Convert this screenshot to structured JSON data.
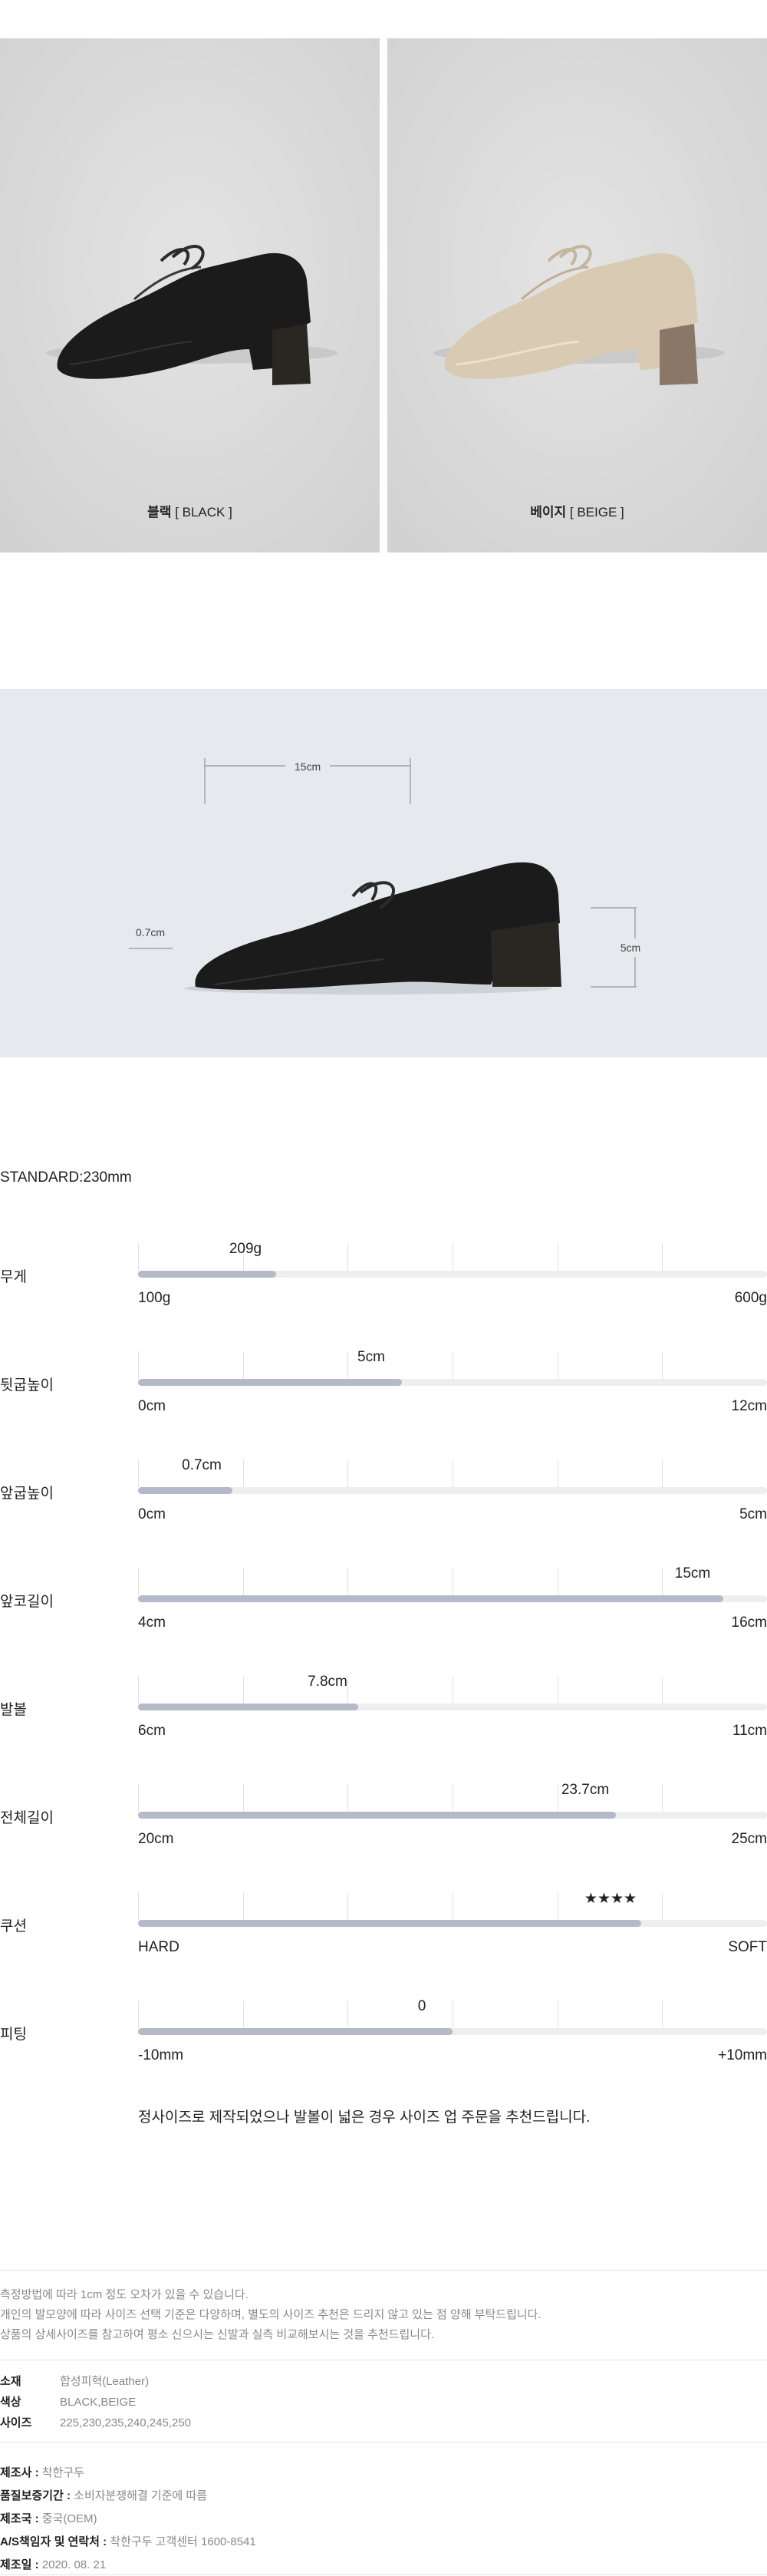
{
  "colors": [
    {
      "name": "블랙",
      "code": "[ BLACK ]",
      "shoe_color": "#1d1d1d",
      "heel_color": "#2a2622",
      "bg": "#dcdcdc"
    },
    {
      "name": "베이지",
      "code": "[ BEIGE ]",
      "shoe_color": "#d8c9b3",
      "heel_color": "#8a7767",
      "bg": "#dcdcdc"
    }
  ],
  "size_diagram": {
    "length": "15cm",
    "toe_height": "0.7cm",
    "heel_height": "5cm",
    "bg": "#e6e9ed"
  },
  "standard": "STANDARD:230mm",
  "specs": [
    {
      "label": "무게",
      "value": "209g",
      "min": "100g",
      "max": "600g",
      "level": 0.22
    },
    {
      "label": "뒷굽높이",
      "value": "5cm",
      "min": "0cm",
      "max": "12cm",
      "level": 0.42
    },
    {
      "label": "앞굽높이",
      "value": "0.7cm",
      "min": "0cm",
      "max": "5cm",
      "level": 0.15
    },
    {
      "label": "앞코길이",
      "value": "15cm",
      "min": "4cm",
      "max": "16cm",
      "level": 0.93
    },
    {
      "label": "발볼",
      "value": "7.8cm",
      "min": "6cm",
      "max": "11cm",
      "level": 0.35
    },
    {
      "label": "전체길이",
      "value": "23.7cm",
      "min": "20cm",
      "max": "25cm",
      "level": 0.76
    },
    {
      "label": "쿠션",
      "value": "★★★★",
      "min": "HARD",
      "max": "SOFT",
      "level": 0.8
    },
    {
      "label": "피팅",
      "value": "0",
      "min": "-10mm",
      "max": "+10mm",
      "level": 0.5
    }
  ],
  "note": "정사이즈로 제작되었으나 발볼이 넓은 경우 사이즈 업 주문을 추천드립니다.",
  "measure_notes": [
    "측정방법에 따라 1cm 정도 오차가 있을 수 있습니다.",
    "개인의 발모양에 따라 사이즈 선택 기준은 다양하며, 별도의 사이즈 추천은 드리지 않고 있는 점 양해 부탁드립니다.",
    "상품의 상세사이즈를 참고하여 평소 신으시는 신발과 실측 비교해보시는 것을 추천드립니다."
  ],
  "info": [
    {
      "k": "소재",
      "v": "합성피혁(Leather)"
    },
    {
      "k": "색상",
      "v": "BLACK,BEIGE"
    },
    {
      "k": "사이즈",
      "v": "225,230,235,240,245,250"
    }
  ],
  "maker": [
    {
      "k": "제조사 :",
      "v": "착한구두"
    },
    {
      "k": "품질보증기간 :",
      "v": "소비자분쟁해결 기준에 따름"
    },
    {
      "k": "제조국 :",
      "v": "중국(OEM)"
    },
    {
      "k": "A/S책임자 및 연락처 :",
      "v": "착한구두 고객센터 1600-8541"
    },
    {
      "k": "제조일 :",
      "v": "2020. 08. 21"
    }
  ]
}
